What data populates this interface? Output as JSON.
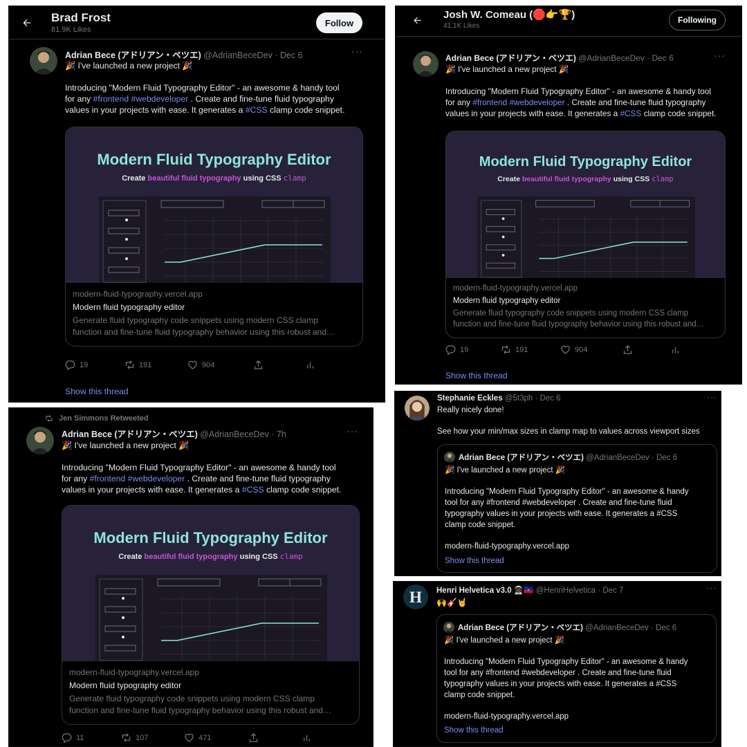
{
  "colors": {
    "hashtag": "#7b8ff0",
    "card_title": "#8ee6d8",
    "card_accent": "#c653d8",
    "muted": "#71767b"
  },
  "panel_a": {
    "back_icon": "arrow-left-icon",
    "profile_name": "Brad Frost",
    "profile_likes": "81.9K Likes",
    "follow_label": "Follow"
  },
  "panel_b": {
    "back_icon": "arrow-left-icon",
    "profile_name": "Josh W. Comeau (🛑👉🏆)",
    "profile_likes": "41.1K Likes",
    "following_label": "Following"
  },
  "tweet": {
    "author_name": "Adrian Bece (アドリアン・ベツエ)",
    "handle": "@AdrianBeceDev",
    "date": "Dec 6",
    "date_alt": "7h",
    "line1": "🎉 I've launched a new project 🎉",
    "intro_1a": "Introducing \"Modern Fluid Typography Editor\" - an awesome & handy tool",
    "intro_1b_pre": "for any ",
    "tag_frontend": "#frontend",
    "tag_webdeveloper": "#webdeveloper",
    "intro_1b_post": " . Create and fine-tune fluid typography",
    "intro_1c_pre": "values in your projects with ease. It generates a ",
    "tag_css": "#CSS",
    "intro_1c_post": " clamp code snippet."
  },
  "card": {
    "image_title": "Modern Fluid Typography Editor",
    "image_sub_pre": "Create ",
    "image_sub_mid": "beautiful fluid typography",
    "image_sub_post": " using CSS ",
    "image_sub_code": "clamp",
    "domain": "modern-fluid-typography.vercel.app",
    "title": "Modern fluid typography editor",
    "desc_line1": "Generate fluid typography code snippets using modern CSS clamp",
    "desc_line2": "function and fine-tune fluid typography behavior using this robust and…"
  },
  "actions_a": {
    "replies": "19",
    "retweets": "191",
    "likes": "904"
  },
  "actions_b": {
    "replies": "19",
    "retweets": "191",
    "likes": "904"
  },
  "actions_c": {
    "replies": "11",
    "retweets": "107",
    "likes": "471"
  },
  "show_thread": "Show this thread",
  "panel_c": {
    "retweeted_by": "Jen Simmons Retweeted"
  },
  "panel_d": {
    "author_name": "Stephanie Eckles",
    "handle": "@5t3ph",
    "date": "Dec 6",
    "line1": "Really nicely done!",
    "line2": "See how your min/max sizes in clamp map to values across viewport sizes"
  },
  "quote": {
    "l1": "Introducing \"Modern Fluid Typography Editor\" - an awesome & handy",
    "l2": "tool for any #frontend #webdeveloper . Create and fine-tune fluid",
    "l3": "typography values in your projects with ease. It generates a #CSS",
    "l4": "clamp code snippet.",
    "link": "modern-fluid-typography.vercel.app"
  },
  "panel_e": {
    "author_name": "Henri Helvetica v3.0 🧑🏿‍🚀🇭🇹",
    "handle": "@HenriHelvetica",
    "date": "Dec 7",
    "line1": "🙌🎸🤘"
  }
}
